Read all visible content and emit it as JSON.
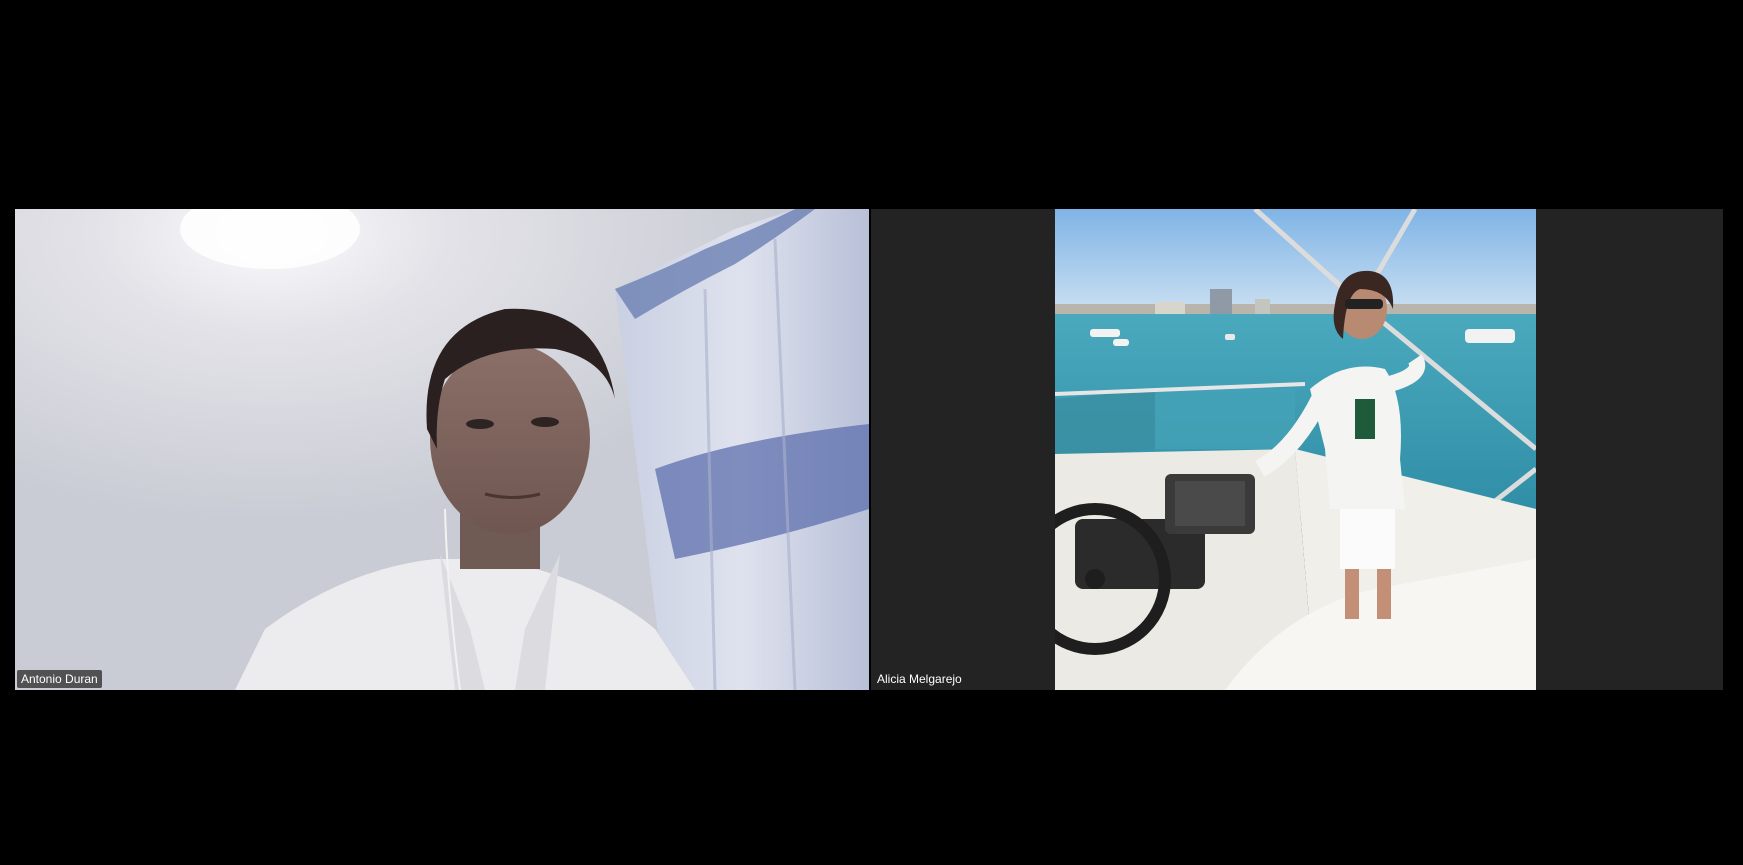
{
  "meeting": {
    "participants": [
      {
        "name": "Antonio Duran",
        "video": "camera-feed"
      },
      {
        "name": "Alicia Melgarejo",
        "video": "profile-photo"
      }
    ]
  },
  "colors": {
    "background": "#000000",
    "tile_background": "#232323",
    "label_text": "#ffffff"
  },
  "icons": {
    "participant_video": "person-video-icon"
  }
}
